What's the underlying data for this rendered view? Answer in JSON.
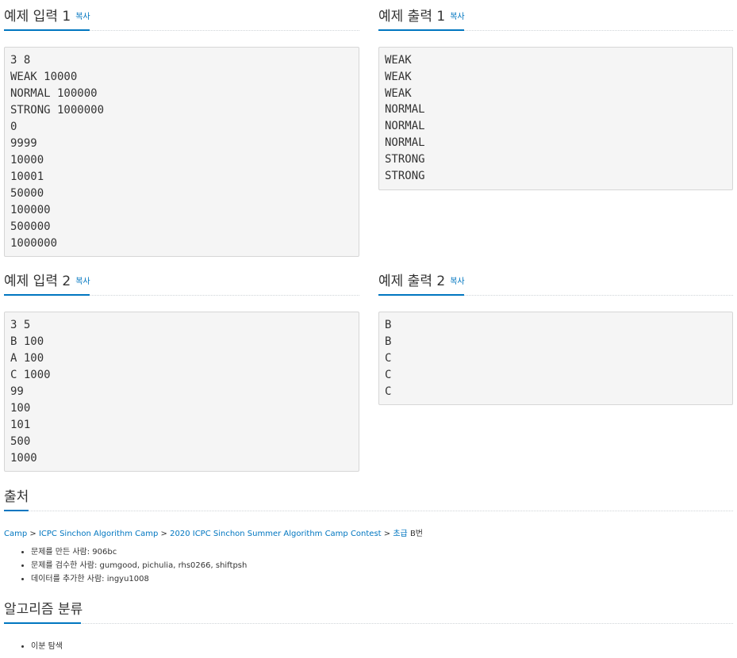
{
  "samples": {
    "in1_title": "예제 입력 1",
    "out1_title": "예제 출력 1",
    "in2_title": "예제 입력 2",
    "out2_title": "예제 출력 2",
    "copy_label": "복사",
    "in1": "3 8\nWEAK 10000\nNORMAL 100000\nSTRONG 1000000\n0\n9999\n10000\n10001\n50000\n100000\n500000\n1000000",
    "out1": "WEAK\nWEAK\nWEAK\nNORMAL\nNORMAL\nNORMAL\nSTRONG\nSTRONG",
    "in2": "3 5\nB 100\nA 100\nC 1000\n99\n100\n101\n500\n1000",
    "out2": "B\nB\nC\nC\nC"
  },
  "source": {
    "title": "출처",
    "crumb_camp": "Camp",
    "crumb_sep": " > ",
    "crumb_icpc": "ICPC Sinchon Algorithm Camp",
    "crumb_contest": "2020 ICPC Sinchon Summer Algorithm Camp Contest",
    "crumb_level": "초급",
    "crumb_problem": " B번",
    "made_by": "문제를 만든 사람: 906bc",
    "reviewed_by": "문제를 검수한 사람: gumgood, pichulia, rhs0266, shiftpsh",
    "data_by": "데이터를 추가한 사람: ingyu1008"
  },
  "algorithm": {
    "title": "알고리즘 분류",
    "tag1": "이분 탐색"
  }
}
